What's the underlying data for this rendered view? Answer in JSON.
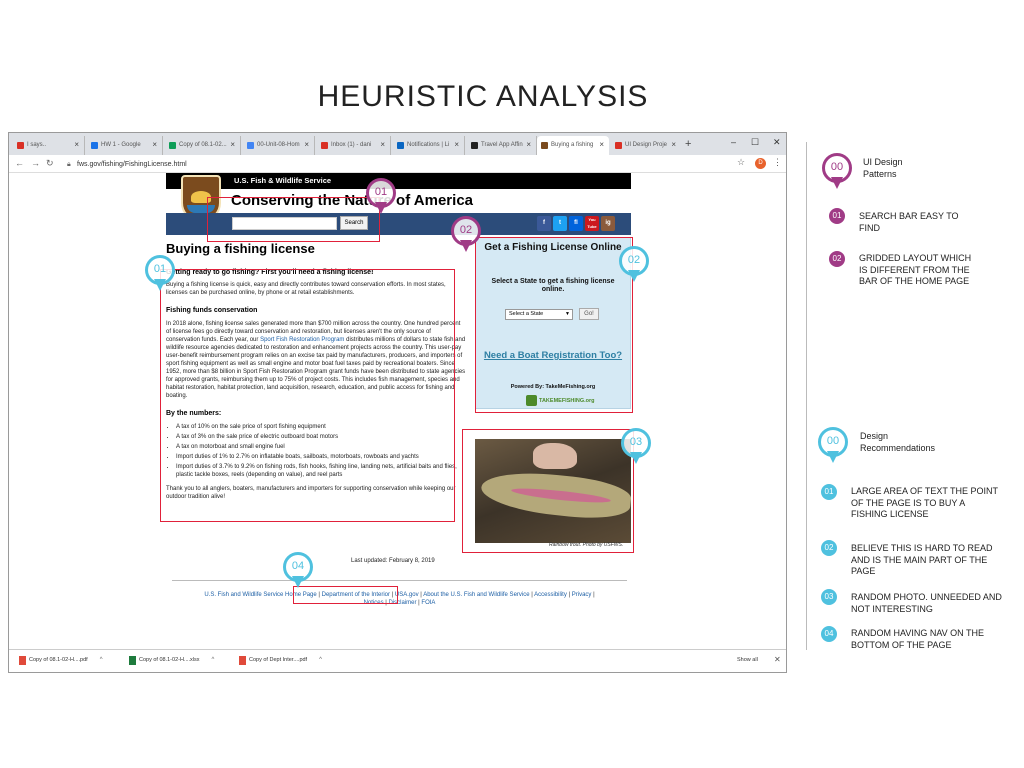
{
  "page_title": "HEURISTIC ANALYSIS",
  "browser": {
    "tabs": [
      {
        "label": "I says..",
        "color": "#d93025"
      },
      {
        "label": "HW 1 - Google",
        "color": "#1a73e8"
      },
      {
        "label": "Copy of 08.1-02...",
        "color": "#0f9d58"
      },
      {
        "label": "00-Unit-08-Hom",
        "color": "#4285f4"
      },
      {
        "label": "Inbox (1) - dani",
        "color": "#d93025"
      },
      {
        "label": "Notifications | Li",
        "color": "#0a66c2"
      },
      {
        "label": "Travel App Affin",
        "color": "#222222"
      },
      {
        "label": "Buying a fishing",
        "color": "#7b4b1e"
      },
      {
        "label": "UI Design Proje",
        "color": "#d93025"
      }
    ],
    "url": "fws.gov/fishing/FishingLicense.html",
    "avatar_letter": "D",
    "downloads": [
      {
        "label": "Copy of 08.1-02-H....pdf"
      },
      {
        "label": "Copy of 08.1-02-H....xlsx"
      },
      {
        "label": "Copy of Dept Inter....pdf"
      }
    ],
    "show_all": "Show all"
  },
  "site": {
    "agency": "U.S. Fish & Wildlife Service",
    "tagline": "Conserving the Nature of America",
    "search_button": "Search",
    "social": [
      "f",
      "t",
      "fl",
      "You Tube",
      "ig"
    ],
    "heading": "Buying a fishing license",
    "intro_heading": "Getting ready to go fishing? First you'll need a fishing license!",
    "intro_text": "Buying a fishing license is quick, easy and directly contributes toward conservation efforts. In most states, licenses can be purchased online, by phone or at retail establishments.",
    "funds_heading": "Fishing funds conservation",
    "funds_text_1": "In 2018 alone, fishing license sales generated more than $700 million across the country. One hundred percent of license fees go directly toward conservation and restoration, but licenses aren't the only source of conservation funds. Each year, our",
    "funds_link": "Sport Fish Restoration Program",
    "funds_text_2": "distributes millions of dollars to state fish and wildlife resource agencies dedicated to restoration and enhancement projects across the country. This user-pay user-benefit reimbursement program relies on an excise tax paid by manufacturers, producers, and importers of sport fishing equipment as well as small engine and motor boat fuel taxes paid by recreational boaters. Since 1952, more than $8 billion in Sport Fish Restoration Program grant funds have been distributed to state agencies for approved grants, reimbursing them up to 75% of project costs. This includes fish management, species and habitat restoration, habitat protection, land acquisition, research, education, and public access for fishing and boating.",
    "numbers_heading": "By the numbers:",
    "numbers": [
      "A tax of 10% on the sale price of sport fishing equipment",
      "A tax of 3% on the sale price of electric outboard boat motors",
      "A tax on motorboat and small engine fuel",
      "Import duties of 1% to 2.7% on inflatable boats, sailboats, motorboats, rowboats and yachts",
      "Import duties of 3.7% to 9.2% on fishing rods, fish hooks, fishing line, landing nets, artificial baits and flies, plastic tackle boxes, reels (depending on value), and reel parts"
    ],
    "thanks": "Thank you to all anglers, boaters, manufacturers and importers for supporting conservation while keeping our outdoor tradition alive!",
    "sidebox": {
      "title": "Get a Fishing License Online",
      "subtitle": "Select a State to get a fishing license online.",
      "select_value": "Select a State",
      "go": "Go!",
      "boat": "Need a Boat Registration Too?",
      "powered": "Powered By: TakeMeFishing.org",
      "tmf": "TAKEMEFISHING.org"
    },
    "photo_caption": "Rainbow trout. Photo by USFWS.",
    "last_updated": "Last updated: February 8, 2019",
    "footer_links": [
      "U.S. Fish and Wildlife Service Home Page",
      "Department of the Interior",
      "USA.gov",
      "About the U.S. Fish and Wildlife Service",
      "Accessibility",
      "Privacy",
      "Notices",
      "Disclaimer",
      "FOIA"
    ]
  },
  "pins": {
    "p01": "01",
    "p02": "02",
    "p03": "03",
    "p04": "04",
    "p01b": "01",
    "p02b": "02"
  },
  "legend": {
    "patterns_badge": "00",
    "patterns_title": "UI Design Patterns",
    "patterns": [
      {
        "num": "01",
        "text": "SEARCH BAR EASY TO FIND"
      },
      {
        "num": "02",
        "text": "GRIDDED LAYOUT WHICH IS DIFFERENT FROM THE BAR OF THE HOME PAGE"
      }
    ],
    "recs_badge": "00",
    "recs_title": "Design Recommendations",
    "recs": [
      {
        "num": "01",
        "text": "LARGE AREA OF TEXT THE POINT OF THE PAGE IS TO BUY A FISHING LICENSE"
      },
      {
        "num": "02",
        "text": "BELIEVE THIS IS HARD TO READ AND IS THE MAIN PART OF THE PAGE"
      },
      {
        "num": "03",
        "text": "RANDOM PHOTO. UNNEEDED AND NOT INTERESTING"
      },
      {
        "num": "04",
        "text": "RANDOM HAVING NAV ON THE BOTTOM OF THE PAGE"
      }
    ]
  }
}
